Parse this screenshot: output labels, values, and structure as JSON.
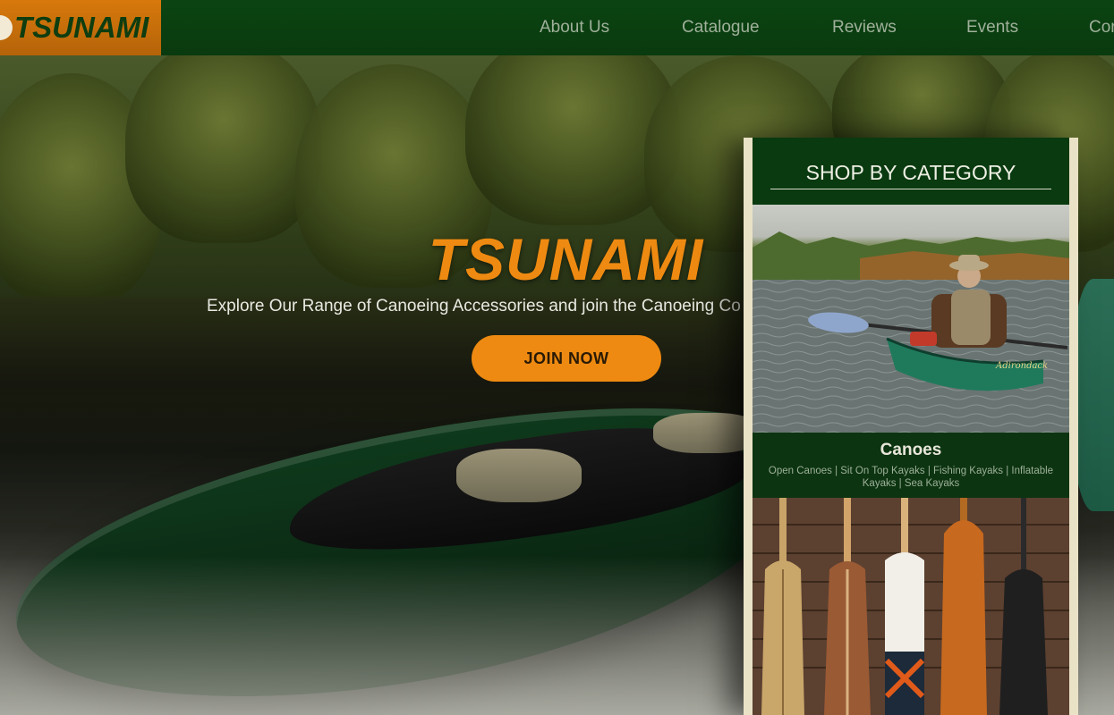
{
  "brand": {
    "logo_text": "TSUNAMI",
    "accent_color": "#ee8a11",
    "header_color": "#0a3a0f"
  },
  "nav": {
    "items": [
      "About Us",
      "Catalogue",
      "Reviews",
      "Events",
      "Cor"
    ]
  },
  "hero": {
    "title": "TSUNAMI",
    "subtitle": "Explore Our Range of Canoeing Accessories and join the Canoeing Co",
    "cta_label": "JOIN NOW"
  },
  "shop": {
    "title": "SHOP BY CATEGORY",
    "categories": [
      {
        "name": "Canoes",
        "subcategories": "Open Canoes | Sit On Top Kayaks | Fishing Kayaks | Inflatable Kayaks | Sea Kayaks",
        "canoe_label": "Adirondack"
      }
    ]
  }
}
